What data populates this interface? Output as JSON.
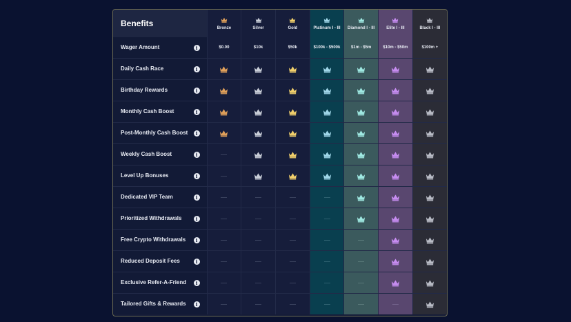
{
  "table": {
    "title": "Benefits",
    "info_glyph": "i",
    "tiers": [
      {
        "key": "bronze",
        "name": "Bronze",
        "wager": "$0.00",
        "crown_color": "#e0a05a"
      },
      {
        "key": "silver",
        "name": "Silver",
        "wager": "$10k",
        "crown_color": "#c9ced8"
      },
      {
        "key": "gold",
        "name": "Gold",
        "wager": "$50k",
        "crown_color": "#f1cf6b"
      },
      {
        "key": "platinum",
        "name": "Platinum I - III",
        "wager": "$100k - $500k",
        "crown_color": "#9fd6e8"
      },
      {
        "key": "diamond",
        "name": "Diamond I - III",
        "wager": "$1m - $5m",
        "crown_color": "#9fe9e2"
      },
      {
        "key": "elite",
        "name": "Elite I - III",
        "wager": "$10m - $50m",
        "crown_color": "#c68cf0"
      },
      {
        "key": "black",
        "name": "Black I - III",
        "wager": "$100m +",
        "crown_color": "#b9bcc6"
      }
    ],
    "wager_label": "Wager Amount",
    "rows": [
      {
        "label": "Daily Cash Race",
        "availability": [
          true,
          true,
          true,
          true,
          true,
          true,
          true
        ]
      },
      {
        "label": "Birthday Rewards",
        "availability": [
          true,
          true,
          true,
          true,
          true,
          true,
          true
        ]
      },
      {
        "label": "Monthly Cash Boost",
        "availability": [
          true,
          true,
          true,
          true,
          true,
          true,
          true
        ]
      },
      {
        "label": "Post-Monthly Cash Boost",
        "availability": [
          true,
          true,
          true,
          true,
          true,
          true,
          true
        ]
      },
      {
        "label": "Weekly Cash Boost",
        "availability": [
          false,
          true,
          true,
          true,
          true,
          true,
          true
        ]
      },
      {
        "label": "Level Up Bonuses",
        "availability": [
          false,
          true,
          true,
          true,
          true,
          true,
          true
        ]
      },
      {
        "label": "Dedicated VIP Team",
        "availability": [
          false,
          false,
          false,
          false,
          true,
          true,
          true
        ]
      },
      {
        "label": "Prioritized Withdrawals",
        "availability": [
          false,
          false,
          false,
          false,
          true,
          true,
          true
        ]
      },
      {
        "label": "Free Crypto Withdrawals",
        "availability": [
          false,
          false,
          false,
          false,
          false,
          true,
          true
        ]
      },
      {
        "label": "Reduced Deposit Fees",
        "availability": [
          false,
          false,
          false,
          false,
          false,
          true,
          true
        ]
      },
      {
        "label": "Exclusive Refer-A-Friend",
        "availability": [
          false,
          false,
          false,
          false,
          false,
          true,
          true
        ]
      },
      {
        "label": "Tailored Gifts & Rewards",
        "availability": [
          false,
          false,
          false,
          false,
          false,
          false,
          true
        ]
      }
    ]
  }
}
